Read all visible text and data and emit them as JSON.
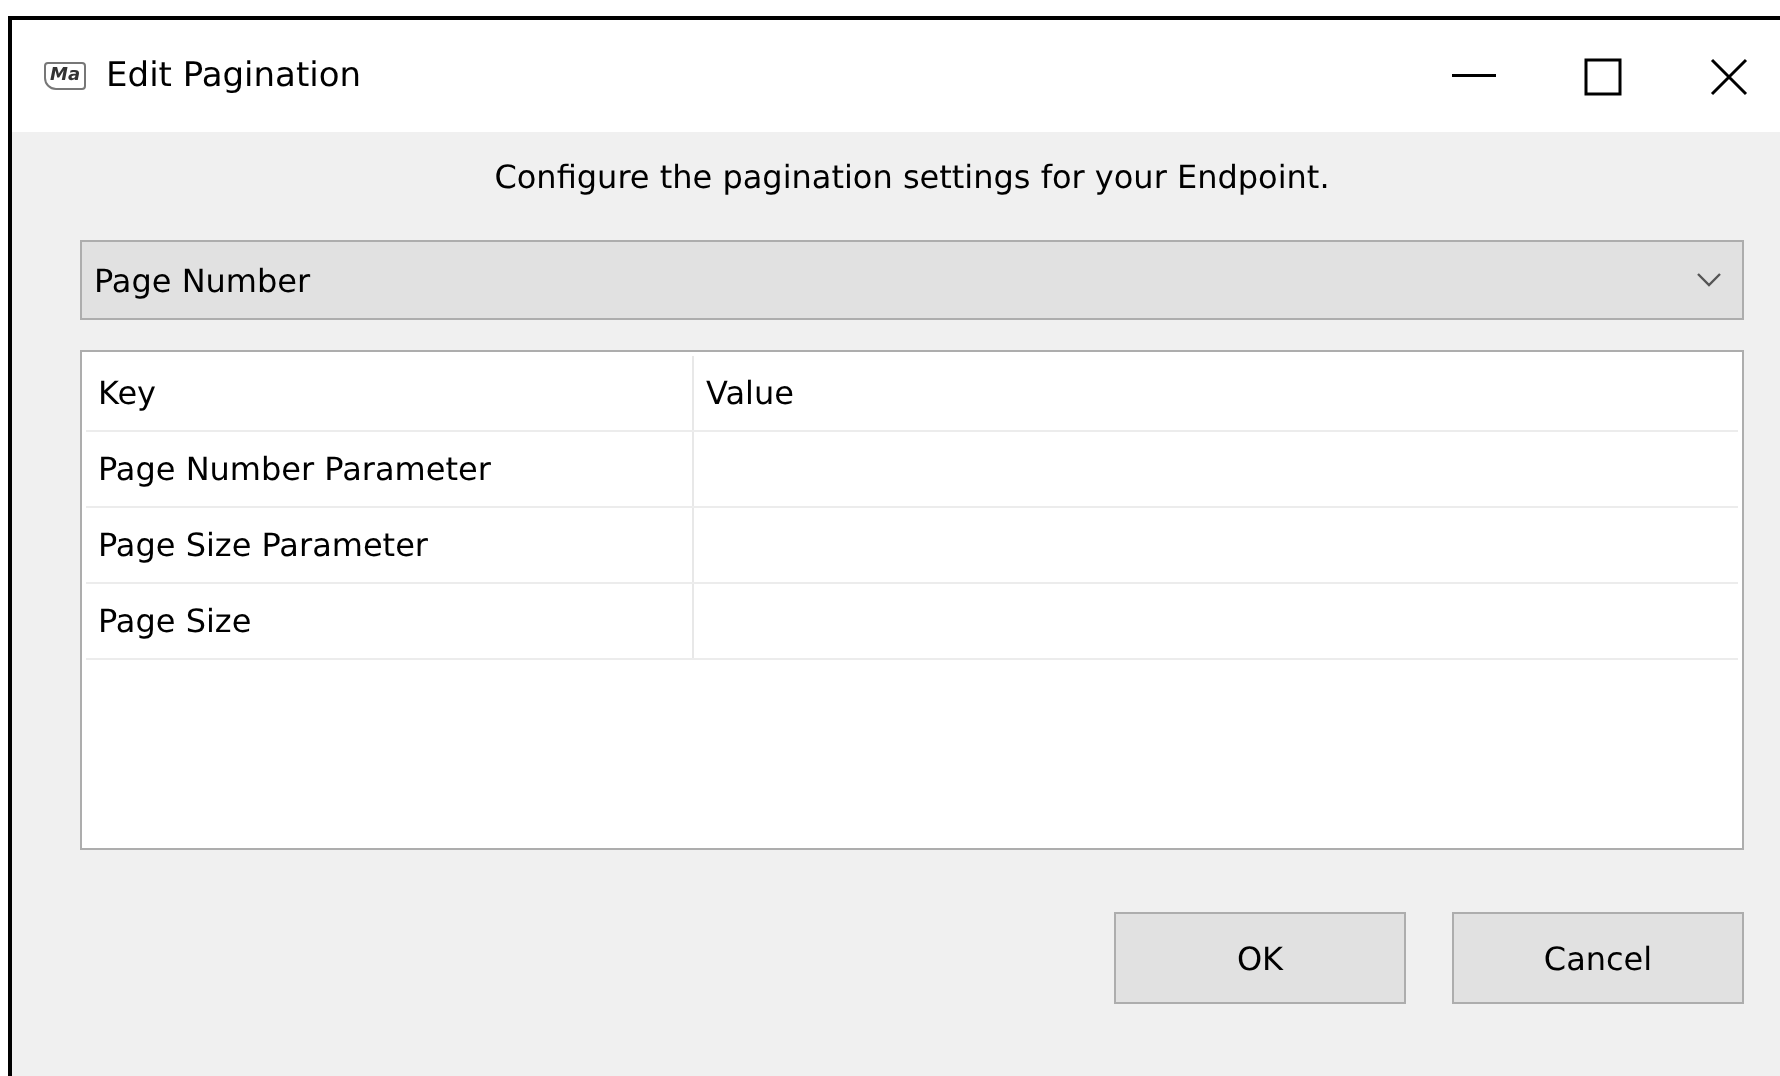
{
  "window": {
    "icon_text": "Ma",
    "title": "Edit Pagination"
  },
  "instruction": "Configure the pagination settings for your Endpoint.",
  "dropdown": {
    "value": "Page Number"
  },
  "table": {
    "columns": [
      "Key",
      "Value"
    ],
    "rows": [
      {
        "key": "Page Number Parameter"
      },
      {
        "key": "Page Size Parameter"
      },
      {
        "key": "Page Size"
      }
    ]
  },
  "buttons": [
    "OK",
    "Cancel"
  ]
}
